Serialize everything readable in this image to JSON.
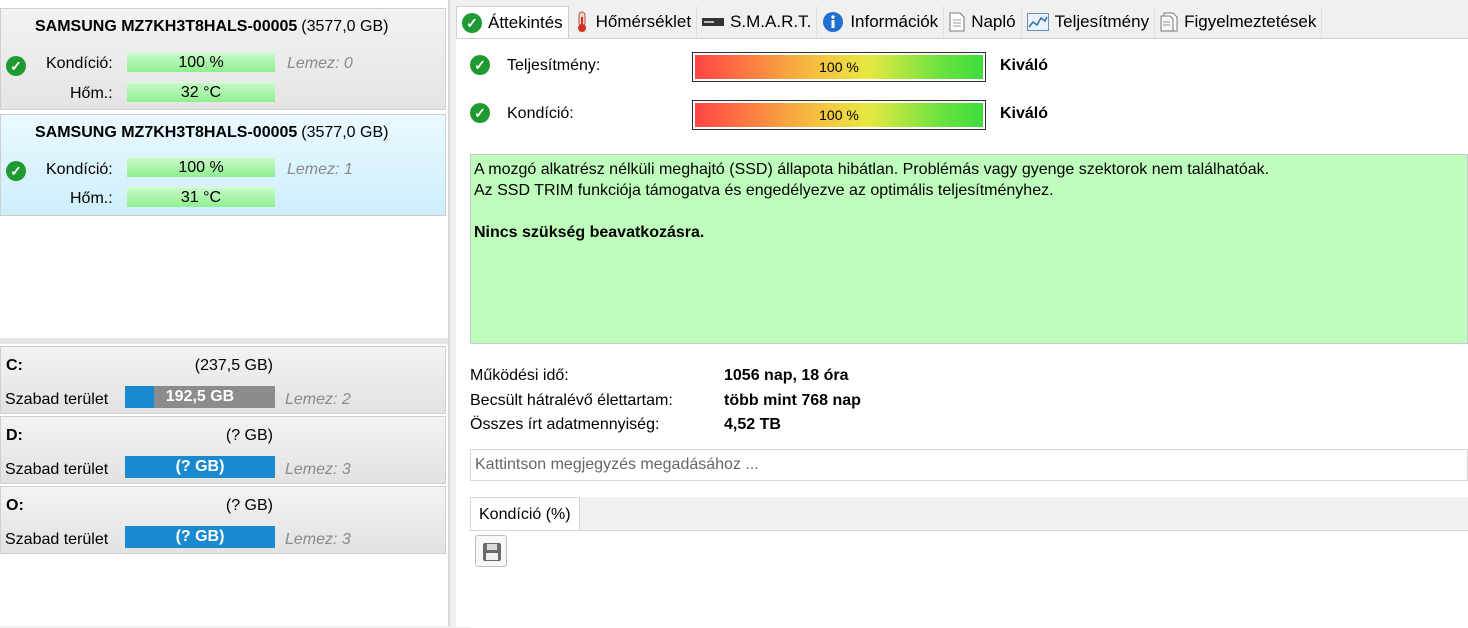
{
  "disks": [
    {
      "name": "SAMSUNG MZ7KH3T8HALS-00005",
      "size": "(3577,0 GB)",
      "health_label": "Kondíció:",
      "health": "100 %",
      "temp_label": "Hőm.:",
      "temp": "32 °C",
      "lemez": "Lemez: 0",
      "health_icon": "check-circle-icon"
    },
    {
      "name": "SAMSUNG MZ7KH3T8HALS-00005",
      "size": "(3577,0 GB)",
      "health_label": "Kondíció:",
      "health": "100 %",
      "temp_label": "Hőm.:",
      "temp": "31 °C",
      "lemez": "Lemez: 1",
      "health_icon": "check-circle-icon"
    }
  ],
  "volumes": [
    {
      "letter": "C:",
      "size": "(237,5 GB)",
      "free_label": "Szabad terület",
      "free": "192,5 GB",
      "lemez": "Lemez: 2",
      "free_fraction": 0.19
    },
    {
      "letter": "D:",
      "size": "(? GB)",
      "free_label": "Szabad terület",
      "free": "(? GB)",
      "lemez": "Lemez: 3",
      "free_fraction": 1.0
    },
    {
      "letter": "O:",
      "size": "(? GB)",
      "free_label": "Szabad terület",
      "free": "(? GB)",
      "lemez": "Lemez: 3",
      "free_fraction": 1.0
    }
  ],
  "tabs": [
    {
      "label": "Áttekintés",
      "icon": "check-circle-icon"
    },
    {
      "label": "Hőmérséklet",
      "icon": "thermometer-icon"
    },
    {
      "label": "S.M.A.R.T.",
      "icon": "drive-icon"
    },
    {
      "label": "Információk",
      "icon": "info-icon"
    },
    {
      "label": "Napló",
      "icon": "document-icon"
    },
    {
      "label": "Teljesítmény",
      "icon": "performance-chart-icon"
    },
    {
      "label": "Figyelmeztetések",
      "icon": "alerts-icon"
    }
  ],
  "ratings": {
    "performance": {
      "label": "Teljesítmény:",
      "bar": "100 %",
      "value": "Kiváló",
      "level": 1.0
    },
    "health": {
      "label": "Kondíció:",
      "bar": "100 %",
      "value": "Kiváló",
      "level": 1.0
    }
  },
  "status": {
    "line1": "A mozgó alkatrész nélküli meghajtó (SSD) állapota hibátlan. Problémás vagy gyenge szektorok nem találhatóak.",
    "line2": "Az SSD TRIM funkciója támogatva és engedélyezve az optimális teljesítményhez.",
    "bold": "Nincs szükség beavatkozásra."
  },
  "stats": {
    "uptime": {
      "label": "Működési idő:",
      "value": "1056 nap, 18 óra"
    },
    "lifetime": {
      "label": "Becsült hátralévő élettartam:",
      "value": "több mint 768 nap"
    },
    "written": {
      "label": "Összes írt adatmennyiség:",
      "value": "4,52 TB"
    }
  },
  "note_placeholder": "Kattintson megjegyzés megadásához ...",
  "chart_tab": "Kondíció  (%)",
  "colors": {
    "ok_green": "#1f9a32",
    "status_bg": "#bffdbc",
    "selected_disk": "#cdeefb",
    "volume_fill": "#1a8ad0"
  }
}
